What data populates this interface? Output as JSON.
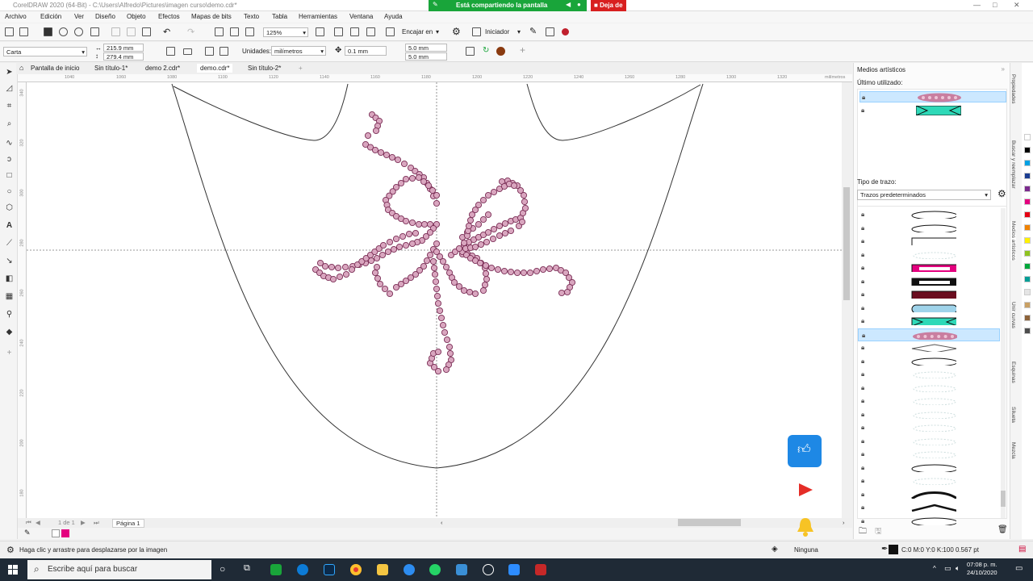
{
  "window": {
    "title": "CorelDRAW 2020 (64-Bit) - C:\\Users\\Alfredo\\Pictures\\imagen curso\\demo.cdr*",
    "share_banner": "Está compartiendo la pantalla",
    "stop_share": "Deja de"
  },
  "menu": [
    "Archivo",
    "Edición",
    "Ver",
    "Diseño",
    "Objeto",
    "Efectos",
    "Mapas de bits",
    "Texto",
    "Tabla",
    "Herramientas",
    "Ventana",
    "Ayuda"
  ],
  "toolbar": {
    "zoom": "125%",
    "snap_to": "Encajar en",
    "launcher": "Iniciador"
  },
  "propertybar": {
    "page_preset": "Carta",
    "width": "215.9 mm",
    "height": "279.4 mm",
    "units_label": "Unidades:",
    "units_value": "milímetros",
    "nudge": "0.1 mm",
    "dup_x": "5.0 mm",
    "dup_y": "5.0 mm"
  },
  "tabs": [
    "Pantalla de inicio",
    "Sin título-1*",
    "demo 2.cdr*",
    "demo.cdr*",
    "Sin título-2*"
  ],
  "active_tab": "demo.cdr*",
  "ruler": {
    "h_ticks": [
      "1040",
      "1060",
      "1080",
      "1100",
      "1120",
      "1140",
      "1160",
      "1180",
      "1200",
      "1220",
      "1240",
      "1260",
      "1280",
      "1300",
      "1320",
      "1340"
    ],
    "unit": "milímetros",
    "v_ticks": [
      "340",
      "320",
      "300",
      "280",
      "260",
      "240",
      "220",
      "200",
      "180",
      "160"
    ]
  },
  "pagebar": {
    "page_of": "1 de 1",
    "page_tab": "Página 1"
  },
  "status": {
    "hint": "Haga clic y arrastre para desplazarse por la imagen",
    "fill": "Ninguna",
    "outline": "C:0 M:0 Y:0 K:100  0.567 pt"
  },
  "docker": {
    "title": "Medios artísticos",
    "recent_label": "Último utilizado:",
    "stroke_type_label": "Tipo de trazo:",
    "stroke_type_value": "Trazos predeterminados"
  },
  "right_tabs": [
    "Propiedades",
    "Buscar y reemplazar",
    "Medios artísticos",
    "Unir curvas",
    "Esquinas",
    "Silueta",
    "Mezcla"
  ],
  "palette_colors": [
    "#ffffff",
    "#000000",
    "#00a0e3",
    "#1b3d91",
    "#7b2a8e",
    "#e4007f",
    "#e50012",
    "#f08200",
    "#fff100",
    "#8fc31f",
    "#00a73c",
    "#009e96",
    "#e5e5e5",
    "#c9a063",
    "#8c6239",
    "#4d4d4d"
  ],
  "taskbar": {
    "search_placeholder": "Escribe aquí para buscar",
    "time": "07:08 p. m.",
    "date": "24/10/2020"
  }
}
